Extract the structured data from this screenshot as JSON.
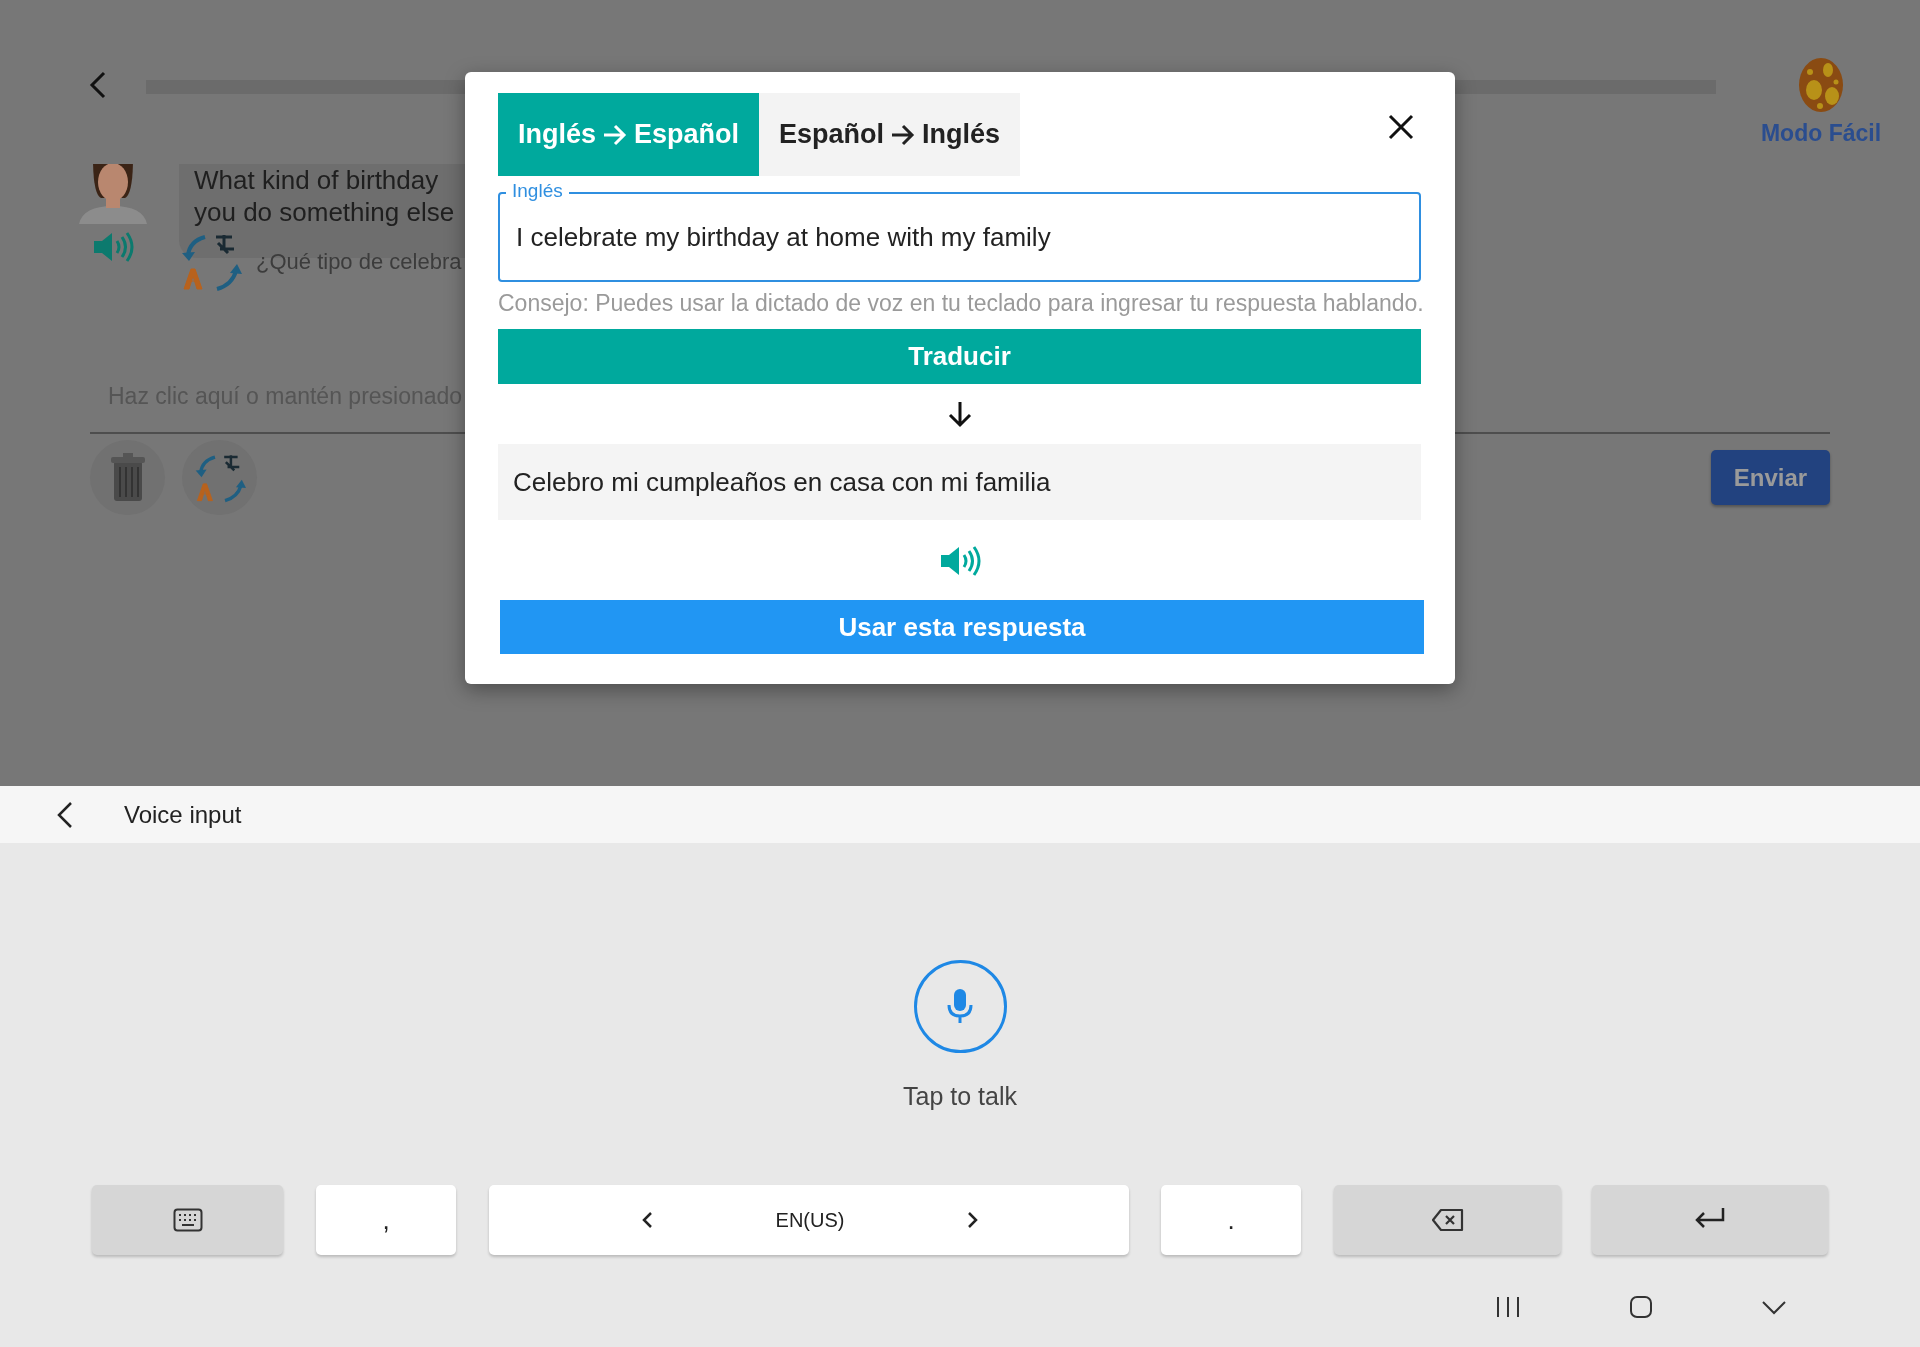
{
  "app": {
    "progress": {
      "level": 0
    },
    "mode_label": "Modo Fácil",
    "message": {
      "lines": [
        "What kind of birthday",
        "you do something else"
      ],
      "translation": "¿Qué tipo de celebra"
    },
    "answer_placeholder": "Haz clic aquí o mantén presionado",
    "send_button": "Enviar"
  },
  "dialog": {
    "tabs": [
      {
        "from": "Inglés",
        "to": "Español",
        "selected": true
      },
      {
        "from": "Español",
        "to": "Inglés",
        "selected": false
      }
    ],
    "input": {
      "label": "Inglés",
      "value": "I celebrate my birthday at home with my family"
    },
    "hint": "Consejo: Puedes usar la dictado de voz en tu teclado para ingresar tu respuesta hablando.",
    "translate_button": "Traducir",
    "result": "Celebro mi cumpleaños en casa con mi familia",
    "use_button": "Usar esta respuesta"
  },
  "keyboard": {
    "header": "Voice input",
    "prompt": "Tap to talk",
    "comma_key": ",",
    "language": "EN(US)",
    "period_key": "."
  }
}
